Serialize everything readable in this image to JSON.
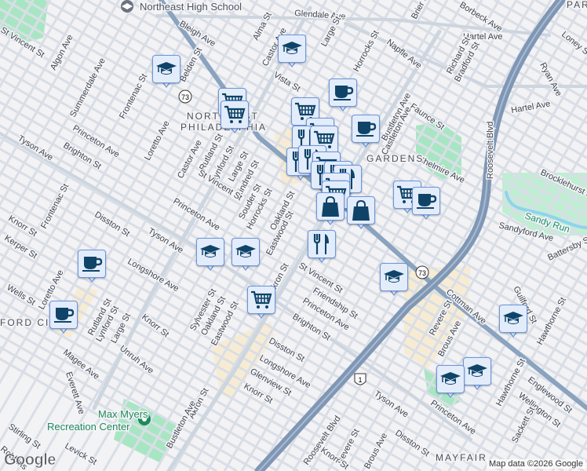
{
  "map": {
    "colors": {
      "background": "#f3f2f4",
      "park": "#a8e6c3",
      "commercial": "#f7ecd3",
      "highway": "#8aa3bf",
      "street": "#d7dde5",
      "marker_fill": "#e3ecfb",
      "marker_border": "#6b96dc",
      "icon": "#0f4468"
    },
    "shields": [
      "73",
      "73",
      "1"
    ],
    "labels": [
      "Northeast High School",
      "Glendale Ave",
      "Algon Ave",
      "Summerdale Ave",
      "St Vincent St",
      "Bleigh Ave",
      "Belden St",
      "Alma St",
      "Castor Ave",
      "Vista St",
      "Large St",
      "Napfle Ave",
      "Hartel Ave",
      "Hartel Ave",
      "Borbeck Ave",
      "Brier St",
      "Richard St",
      "Bradford St",
      "Ryan Ave",
      "Faunce St",
      "Bustleton Ave",
      "Roosevelt Blvd",
      "Shelmire Ave",
      "Brocklehurst St",
      "Sandy Run",
      "Sandyford Ave",
      "Frontenac St",
      "NORTHEAST",
      "PHILADELPHIA",
      "Loretto Ave",
      "Castor Ave",
      "Rutland St",
      "Lynford St",
      "Large St",
      "Kindred St",
      "Souder St",
      "Horrocks St",
      "Oakland St",
      "Tyson Ave",
      "Princeton Ave",
      "Brighton St",
      "Princeton Ave",
      "St Vincent St",
      "Frontenac St",
      "Disston St",
      "Knorr St",
      "Tyson Ave",
      "Longshore Ave",
      "Kerper St",
      "Wells St",
      "Loretto Ave",
      "FORD CIR",
      "Rutland St",
      "Lynford St",
      "Large St",
      "Knorr St",
      "Unruh Ave",
      "Magee Ave",
      "Everett Ave",
      "Sylvester St",
      "Oakland St",
      "Eastwood St",
      "Akron St",
      "Eastwood St",
      "Friendship St",
      "St Vincent St",
      "Princeton Ave",
      "Brighton St",
      "Disston St",
      "Longshore Ave",
      "Glenview St",
      "Knorr St",
      "Akron St",
      "Bustleton Ave",
      "Max Myers",
      "Recreation Center",
      "Stirling St",
      "Robbins",
      "Levick St",
      "Cottman Ave",
      "Revere St",
      "Brous Ave",
      "Guilford St",
      "Hawthorne St",
      "Battersby St",
      "Roosevelt Blvd",
      "Tyson Ave",
      "Princeton Ave",
      "Hawthorne St",
      "Englewood St",
      "Wellington St",
      "Sackett St",
      "Revere St",
      "Brous Ave",
      "Disston St",
      "Knorr St",
      "MAYFAIR",
      "PARK",
      "GARDENS",
      "Horrocks St",
      "Castleton Ave",
      "Loney St"
    ],
    "markers": [
      "school",
      "school",
      "grocery",
      "grocery",
      "grocery",
      "cafe",
      "cafe",
      "grocery",
      "restaurant",
      "grocery",
      "restaurant",
      "restaurant",
      "grocery",
      "restaurant",
      "restaurant",
      "restaurant",
      "grocery",
      "grocery",
      "shopping",
      "shopping",
      "grocery",
      "cafe",
      "restaurant",
      "school",
      "school",
      "cafe",
      "grocery",
      "cafe",
      "school",
      "school",
      "school",
      "school"
    ],
    "attribution": "Map data ©2026 Google",
    "logo": "Google"
  }
}
